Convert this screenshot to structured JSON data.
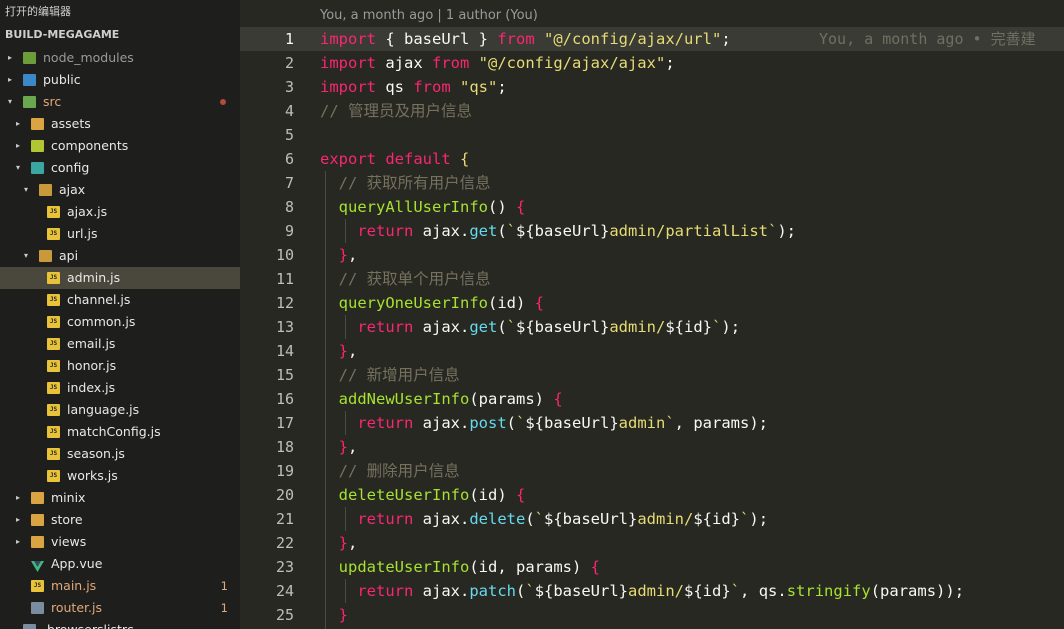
{
  "sidebar": {
    "open_editors_label": "打开的编辑器",
    "project_label": "BUILD-MEGAGAME",
    "items": [
      {
        "label": "node_modules",
        "depth": 0,
        "type": "folder",
        "icon": "node",
        "expanded": false,
        "dim": true
      },
      {
        "label": "public",
        "depth": 0,
        "type": "folder",
        "icon": "pub",
        "expanded": false
      },
      {
        "label": "src",
        "depth": 0,
        "type": "folder",
        "icon": "src",
        "expanded": true,
        "modified": true,
        "dot": true
      },
      {
        "label": "assets",
        "depth": 1,
        "type": "folder",
        "icon": "folder",
        "expanded": false
      },
      {
        "label": "components",
        "depth": 1,
        "type": "folder",
        "icon": "comp",
        "expanded": false
      },
      {
        "label": "config",
        "depth": 1,
        "type": "folder",
        "icon": "cfg",
        "expanded": true
      },
      {
        "label": "ajax",
        "depth": 2,
        "type": "folder",
        "icon": "folder",
        "expanded": true
      },
      {
        "label": "ajax.js",
        "depth": 3,
        "type": "file",
        "icon": "js"
      },
      {
        "label": "url.js",
        "depth": 3,
        "type": "file",
        "icon": "js"
      },
      {
        "label": "api",
        "depth": 2,
        "type": "folder",
        "icon": "folder",
        "expanded": true
      },
      {
        "label": "admin.js",
        "depth": 3,
        "type": "file",
        "icon": "js",
        "selected": true
      },
      {
        "label": "channel.js",
        "depth": 3,
        "type": "file",
        "icon": "js"
      },
      {
        "label": "common.js",
        "depth": 3,
        "type": "file",
        "icon": "js"
      },
      {
        "label": "email.js",
        "depth": 3,
        "type": "file",
        "icon": "js"
      },
      {
        "label": "honor.js",
        "depth": 3,
        "type": "file",
        "icon": "js"
      },
      {
        "label": "index.js",
        "depth": 3,
        "type": "file",
        "icon": "js"
      },
      {
        "label": "language.js",
        "depth": 3,
        "type": "file",
        "icon": "js"
      },
      {
        "label": "matchConfig.js",
        "depth": 3,
        "type": "file",
        "icon": "js"
      },
      {
        "label": "season.js",
        "depth": 3,
        "type": "file",
        "icon": "js"
      },
      {
        "label": "works.js",
        "depth": 3,
        "type": "file",
        "icon": "js"
      },
      {
        "label": "minix",
        "depth": 1,
        "type": "folder",
        "icon": "folder",
        "expanded": false
      },
      {
        "label": "store",
        "depth": 1,
        "type": "folder",
        "icon": "folder",
        "expanded": false
      },
      {
        "label": "views",
        "depth": 1,
        "type": "folder",
        "icon": "folder",
        "expanded": false
      },
      {
        "label": "App.vue",
        "depth": 1,
        "type": "file",
        "icon": "vue"
      },
      {
        "label": "main.js",
        "depth": 1,
        "type": "file",
        "icon": "js",
        "modified": true,
        "badge": "1"
      },
      {
        "label": "router.js",
        "depth": 1,
        "type": "file",
        "icon": "misc",
        "modified": true,
        "badge": "1"
      },
      {
        "label": ".browserslistrc",
        "depth": 0,
        "type": "file",
        "icon": "misc"
      }
    ]
  },
  "editor": {
    "blame_header": "You, a month ago | 1 author (You)",
    "ghost_annotation": "You, a month ago • 完善建",
    "current_line": 1,
    "lines": [
      {
        "n": "1",
        "tokens": [
          {
            "c": "kw",
            "t": "import"
          },
          {
            "c": "pn",
            "t": " { baseUrl } "
          },
          {
            "c": "kw",
            "t": "from"
          },
          {
            "c": "pn",
            "t": " "
          },
          {
            "c": "st",
            "t": "\"@/config/ajax/url\""
          },
          {
            "c": "pn",
            "t": ";"
          }
        ]
      },
      {
        "n": "2",
        "tokens": [
          {
            "c": "kw",
            "t": "import"
          },
          {
            "c": "pn",
            "t": " ajax "
          },
          {
            "c": "kw",
            "t": "from"
          },
          {
            "c": "pn",
            "t": " "
          },
          {
            "c": "st",
            "t": "\"@/config/ajax/ajax\""
          },
          {
            "c": "pn",
            "t": ";"
          }
        ]
      },
      {
        "n": "3",
        "tokens": [
          {
            "c": "kw",
            "t": "import"
          },
          {
            "c": "pn",
            "t": " qs "
          },
          {
            "c": "kw",
            "t": "from"
          },
          {
            "c": "pn",
            "t": " "
          },
          {
            "c": "st",
            "t": "\"qs\""
          },
          {
            "c": "pn",
            "t": ";"
          }
        ]
      },
      {
        "n": "4",
        "tokens": [
          {
            "c": "cm",
            "t": "// 管理员及用户信息"
          }
        ]
      },
      {
        "n": "5",
        "tokens": []
      },
      {
        "n": "6",
        "tokens": [
          {
            "c": "kw",
            "t": "export"
          },
          {
            "c": "pn",
            "t": " "
          },
          {
            "c": "kw",
            "t": "default"
          },
          {
            "c": "pn",
            "t": " "
          },
          {
            "c": "st",
            "t": "{"
          }
        ]
      },
      {
        "n": "7",
        "tokens": [
          {
            "c": "pn",
            "t": "  "
          },
          {
            "c": "cm",
            "t": "// 获取所有用户信息"
          }
        ]
      },
      {
        "n": "8",
        "tokens": [
          {
            "c": "pn",
            "t": "  "
          },
          {
            "c": "fn",
            "t": "queryAllUserInfo"
          },
          {
            "c": "pn",
            "t": "() "
          },
          {
            "c": "kw",
            "t": "{"
          }
        ]
      },
      {
        "n": "9",
        "tokens": [
          {
            "c": "pn",
            "t": "    "
          },
          {
            "c": "kw",
            "t": "return"
          },
          {
            "c": "pn",
            "t": " ajax."
          },
          {
            "c": "mb",
            "t": "get"
          },
          {
            "c": "pn",
            "t": "("
          },
          {
            "c": "st",
            "t": "`"
          },
          {
            "c": "pn",
            "t": "${baseUrl}"
          },
          {
            "c": "st",
            "t": "admin/partialList`"
          },
          {
            "c": "pn",
            "t": ");"
          }
        ]
      },
      {
        "n": "10",
        "tokens": [
          {
            "c": "pn",
            "t": "  "
          },
          {
            "c": "kw",
            "t": "}"
          },
          {
            "c": "pn",
            "t": ","
          }
        ]
      },
      {
        "n": "11",
        "tokens": [
          {
            "c": "pn",
            "t": "  "
          },
          {
            "c": "cm",
            "t": "// 获取单个用户信息"
          }
        ]
      },
      {
        "n": "12",
        "tokens": [
          {
            "c": "pn",
            "t": "  "
          },
          {
            "c": "fn",
            "t": "queryOneUserInfo"
          },
          {
            "c": "pn",
            "t": "(id) "
          },
          {
            "c": "kw",
            "t": "{"
          }
        ]
      },
      {
        "n": "13",
        "tokens": [
          {
            "c": "pn",
            "t": "    "
          },
          {
            "c": "kw",
            "t": "return"
          },
          {
            "c": "pn",
            "t": " ajax."
          },
          {
            "c": "mb",
            "t": "get"
          },
          {
            "c": "pn",
            "t": "("
          },
          {
            "c": "st",
            "t": "`"
          },
          {
            "c": "pn",
            "t": "${baseUrl}"
          },
          {
            "c": "st",
            "t": "admin/"
          },
          {
            "c": "pn",
            "t": "${id}"
          },
          {
            "c": "st",
            "t": "`"
          },
          {
            "c": "pn",
            "t": ");"
          }
        ]
      },
      {
        "n": "14",
        "tokens": [
          {
            "c": "pn",
            "t": "  "
          },
          {
            "c": "kw",
            "t": "}"
          },
          {
            "c": "pn",
            "t": ","
          }
        ]
      },
      {
        "n": "15",
        "tokens": [
          {
            "c": "pn",
            "t": "  "
          },
          {
            "c": "cm",
            "t": "// 新增用户信息"
          }
        ]
      },
      {
        "n": "16",
        "tokens": [
          {
            "c": "pn",
            "t": "  "
          },
          {
            "c": "fn",
            "t": "addNewUserInfo"
          },
          {
            "c": "pn",
            "t": "(params) "
          },
          {
            "c": "kw",
            "t": "{"
          }
        ]
      },
      {
        "n": "17",
        "tokens": [
          {
            "c": "pn",
            "t": "    "
          },
          {
            "c": "kw",
            "t": "return"
          },
          {
            "c": "pn",
            "t": " ajax."
          },
          {
            "c": "mb",
            "t": "post"
          },
          {
            "c": "pn",
            "t": "("
          },
          {
            "c": "st",
            "t": "`"
          },
          {
            "c": "pn",
            "t": "${baseUrl}"
          },
          {
            "c": "st",
            "t": "admin`"
          },
          {
            "c": "pn",
            "t": ", params);"
          }
        ]
      },
      {
        "n": "18",
        "tokens": [
          {
            "c": "pn",
            "t": "  "
          },
          {
            "c": "kw",
            "t": "}"
          },
          {
            "c": "pn",
            "t": ","
          }
        ]
      },
      {
        "n": "19",
        "tokens": [
          {
            "c": "pn",
            "t": "  "
          },
          {
            "c": "cm",
            "t": "// 删除用户信息"
          }
        ]
      },
      {
        "n": "20",
        "tokens": [
          {
            "c": "pn",
            "t": "  "
          },
          {
            "c": "fn",
            "t": "deleteUserInfo"
          },
          {
            "c": "pn",
            "t": "(id) "
          },
          {
            "c": "kw",
            "t": "{"
          }
        ]
      },
      {
        "n": "21",
        "tokens": [
          {
            "c": "pn",
            "t": "    "
          },
          {
            "c": "kw",
            "t": "return"
          },
          {
            "c": "pn",
            "t": " ajax."
          },
          {
            "c": "mb",
            "t": "delete"
          },
          {
            "c": "pn",
            "t": "("
          },
          {
            "c": "st",
            "t": "`"
          },
          {
            "c": "pn",
            "t": "${baseUrl}"
          },
          {
            "c": "st",
            "t": "admin/"
          },
          {
            "c": "pn",
            "t": "${id}"
          },
          {
            "c": "st",
            "t": "`"
          },
          {
            "c": "pn",
            "t": ");"
          }
        ]
      },
      {
        "n": "22",
        "tokens": [
          {
            "c": "pn",
            "t": "  "
          },
          {
            "c": "kw",
            "t": "}"
          },
          {
            "c": "pn",
            "t": ","
          }
        ]
      },
      {
        "n": "23",
        "tokens": [
          {
            "c": "pn",
            "t": "  "
          },
          {
            "c": "fn",
            "t": "updateUserInfo"
          },
          {
            "c": "pn",
            "t": "(id, params) "
          },
          {
            "c": "kw",
            "t": "{"
          }
        ]
      },
      {
        "n": "24",
        "tokens": [
          {
            "c": "pn",
            "t": "    "
          },
          {
            "c": "kw",
            "t": "return"
          },
          {
            "c": "pn",
            "t": " ajax."
          },
          {
            "c": "mb",
            "t": "patch"
          },
          {
            "c": "pn",
            "t": "("
          },
          {
            "c": "st",
            "t": "`"
          },
          {
            "c": "pn",
            "t": "${baseUrl}"
          },
          {
            "c": "st",
            "t": "admin/"
          },
          {
            "c": "pn",
            "t": "${id}"
          },
          {
            "c": "st",
            "t": "`"
          },
          {
            "c": "pn",
            "t": ", qs."
          },
          {
            "c": "fn",
            "t": "stringify"
          },
          {
            "c": "pn",
            "t": "(params));"
          }
        ]
      },
      {
        "n": "25",
        "tokens": [
          {
            "c": "pn",
            "t": "  "
          },
          {
            "c": "kw",
            "t": "}"
          }
        ]
      }
    ]
  }
}
